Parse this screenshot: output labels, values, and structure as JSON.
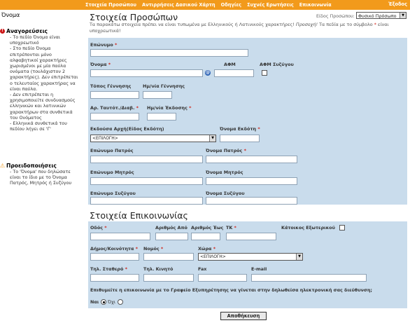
{
  "topnav": {
    "items": [
      "Στοιχεία Προσώπου",
      "Αντιρρήσεις Δασικού Χάρτη",
      "Οδηγίες",
      "Συχνές Ερωτήσεις",
      "Επικοινωνία"
    ],
    "exit": "Έξοδος"
  },
  "sidebar": {
    "title": "Όνομα",
    "sections": [
      {
        "heading": "Αναγορεύσεις",
        "text": "- Το πεδίο Όνομα είναι υποχρεωτικό\n- Στο πεδίο Όνομα επιτρέπονται μόνο αλφαβητικοί χαρακτήρες χωρισμένοι με μία παύλα ονόματα (τουλάχιστον 2 χαρακτήρες). Δεν επιτρέπεται ο τελευταίος χαρακτήρας να είναι παύλα.\n- Δεν επιτρέπεται η χρησιμοποιείτε συνδυασμούς ελληνικών και λατινικών χαρακτήρων στα συνθετικά του Ονόματος\n- Ελληνικά συνθετικά του πεδίου λήγει σε 'Γ'"
      },
      {
        "heading": "Προειδοποιήσεις",
        "text": "- Το 'Όνομα' που δηλώσατε είναι το ίδιο με το Όνομα Πατρός, Μητρός ή Συζύγου"
      }
    ]
  },
  "main": {
    "title": "Στοιχεία Προσώπων",
    "person_type_label": "Είδος Προσώπου:",
    "person_type_value": "Φυσικό Πρόσωπο",
    "intro_text": "Τα παρακάτω στοιχεία πρέπει να είναι τυπωμένα με Ελληνικούς ή Λατινικούς χαρακτήρες!",
    "intro_warning": "Προσοχή!",
    "intro_text2": "Τα πεδία με το σύμβολο",
    "intro_text3": "είναι υποχρεωτικά!",
    "req_mark": "*",
    "fields": {
      "eponymo": "Επώνυμο",
      "onoma": "Όνομα",
      "afm": "ΑΦΜ",
      "afm_syzygou": "ΑΦΜ Συζύγου",
      "topos_gennisis": "Τόπος Γέννησης",
      "im_gennisis": "Ημ/νία Γέννησης",
      "ar_taut": "Αρ. Ταυτότ./Διαβ.",
      "im_ekdosis": "Ημ/νία Έκδοσης",
      "ekdousa_arxi": "Εκδούσα Αρχή(Είδος Εκδότη)",
      "ekdousa_arxi_value": "<ΕΠΙΛΟΓΗ>",
      "onoma_ekdoti": "Όνομα Εκδότη",
      "eponymo_patros": "Επώνυμο Πατρός",
      "onoma_patros": "Όνομα Πατρός",
      "eponymo_mitros": "Επώνυμο Μητρός",
      "onoma_mitros": "Όνομα Μητρός",
      "eponymo_syzygou": "Επώνυμο Συζύγου",
      "onoma_syzygou": "Όνομα Συζύγου"
    },
    "contact_title": "Στοιχεία Επικοινωνίας",
    "contact": {
      "odos": "Οδός",
      "arithmos_apo": "Αριθμός Από",
      "arithmos_eos": "Αριθμός Έως",
      "tk": "ΤΚ",
      "katoikos_ext": "Κάτοικος Εξωτερικού",
      "dimos": "Δήμος/Κοινότητα",
      "nomos": "Νομός",
      "xora": "Χώρα",
      "xora_value": "<ΕΠΙΛΟΓΗ>",
      "til_stathero": "Τηλ. Σταθερό",
      "til_kinito": "Τηλ. Κινητό",
      "fax": "Fax",
      "email": "E-mail",
      "question": "Επιθυμείτε η επικοινωνία με το Γραφείο Εξυπηρέτησης να γίνεται στην δηλωθείσα ηλεκτρονική σας διεύθυνση;",
      "yes": "Ναι",
      "no": "Όχι"
    },
    "save_label": "Αποθήκευση"
  },
  "colors": {
    "topbar": "#f29a1b",
    "panel": "#c9dcec",
    "required": "#d0281e"
  }
}
